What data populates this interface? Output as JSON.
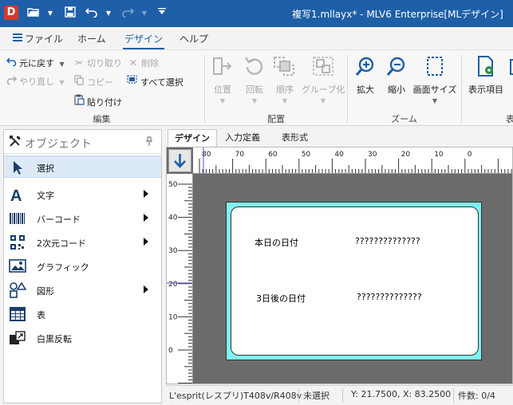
{
  "window": {
    "title": "複写1.mllayx* - MLV6 Enterprise[MLデザイン]",
    "app_logo": "D"
  },
  "quick_access": {
    "icons": [
      "open-icon",
      "save-icon",
      "undo-icon",
      "redo-icon",
      "customize-icon"
    ]
  },
  "ribbon_tabs": [
    {
      "label": "ファイル"
    },
    {
      "label": "ホーム"
    },
    {
      "label": "デザイン",
      "active": true
    },
    {
      "label": "ヘルプ"
    }
  ],
  "ribbon": {
    "edit": {
      "undo": "元に戻す",
      "redo": "やり直し",
      "cut": "切り取り",
      "copy": "コピー",
      "paste": "貼り付け",
      "delete": "削除",
      "select_all": "すべて選択",
      "group_label": "編集"
    },
    "arrange": {
      "position": "位置",
      "rotate": "回転",
      "order": "順序",
      "group": "グループ化",
      "group_label": "配置"
    },
    "zoom": {
      "zoom_in": "拡大",
      "zoom_out": "縮小",
      "screen_size": "画面サイズ",
      "group_label": "ズーム"
    },
    "display": {
      "display_item": "表示項目",
      "group_label_partial": "表"
    }
  },
  "object_panel": {
    "title": "オブジェクト",
    "items": [
      {
        "label": "選択",
        "icon": "cursor-icon",
        "selected": true,
        "submenu": false
      },
      {
        "label": "文字",
        "icon": "text-icon",
        "submenu": true
      },
      {
        "label": "バーコード",
        "icon": "barcode-icon",
        "submenu": true
      },
      {
        "label": "2次元コード",
        "icon": "qrcode-icon",
        "submenu": true
      },
      {
        "label": "グラフィック",
        "icon": "image-icon",
        "submenu": false
      },
      {
        "label": "図形",
        "icon": "shapes-icon",
        "submenu": true
      },
      {
        "label": "表",
        "icon": "table-icon",
        "submenu": false
      },
      {
        "label": "白黒反転",
        "icon": "invert-icon",
        "submenu": false
      }
    ]
  },
  "doc_tabs": [
    {
      "label": "デザイン",
      "active": true
    },
    {
      "label": "入力定義"
    },
    {
      "label": "表形式"
    }
  ],
  "rulers": {
    "horizontal_labels": [
      "80",
      "70",
      "60",
      "50",
      "40",
      "30",
      "20",
      "10",
      "0"
    ],
    "vertical_labels": [
      "50",
      "40",
      "30",
      "20",
      "10",
      "0"
    ]
  },
  "label": {
    "texts": [
      {
        "name": "today-date-label",
        "text": "本日の日付"
      },
      {
        "name": "today-date-value",
        "text": "??????????????"
      },
      {
        "name": "after3-date-label",
        "text": "3日後の日付"
      },
      {
        "name": "after3-date-value",
        "text": "??????????????"
      }
    ]
  },
  "status": {
    "printer": "L'esprit(レスプリ)T408v/R408v",
    "selection": "未選択",
    "coords": "Y: 21.7500, X: 83.2500",
    "count": "件数: 0/4"
  },
  "colors": {
    "title_bar": "#1e5fa8",
    "label_border": "#7ff3f3",
    "canvas_bg": "#6b6b6b",
    "selected_item_bg": "#dce9f7"
  }
}
